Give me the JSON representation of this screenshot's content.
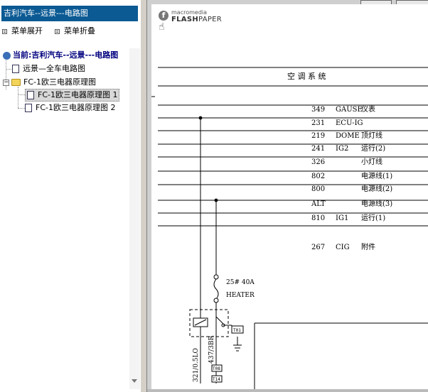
{
  "window": {
    "title": "吉利汽车--远景---电路图"
  },
  "toolbar": {
    "expand_label": "菜单展开",
    "collapse_label": "菜单折叠"
  },
  "tree": {
    "root": "当前:吉利汽车--远景---电路图",
    "items": [
      {
        "label": "远景—全车电路图"
      },
      {
        "label": "FC-1欧三电器原理图"
      },
      {
        "label": "FC-1欧三电器原理图 1"
      },
      {
        "label": "FC-1欧三电器原理图 2"
      }
    ]
  },
  "viewer": {
    "logo_top": "macromedia",
    "logo_bold": "FLASH",
    "logo_light": "PAPER"
  },
  "diagram": {
    "title": "空 调 系 统",
    "rows": [
      {
        "code": "349",
        "name": "GAUSE",
        "desc": "仪表"
      },
      {
        "code": "231",
        "name": "ECU-IG",
        "desc": ""
      },
      {
        "code": "219",
        "name": "DOME",
        "desc": "顶灯线"
      },
      {
        "code": "241",
        "name": "IG2",
        "desc": "运行(2)"
      },
      {
        "code": "326",
        "name": "",
        "desc": "小灯线"
      },
      {
        "code": "802",
        "name": "",
        "desc": "电源线(1)"
      },
      {
        "code": "800",
        "name": "",
        "desc": "电源线(2)"
      },
      {
        "code": "ALT",
        "name": "",
        "desc": "电源线(3)"
      },
      {
        "code": "810",
        "name": "IG1",
        "desc": "运行(1)"
      },
      {
        "code": "267",
        "name": "CIG",
        "desc": "附件"
      }
    ],
    "fuse_label": "25# 40A",
    "fuse_name": "HEATER",
    "wire_1": "321/0.5LO",
    "wire_2": "437/3BR",
    "box_1": "T01",
    "box_2": "T08",
    "box_3": "T14"
  }
}
